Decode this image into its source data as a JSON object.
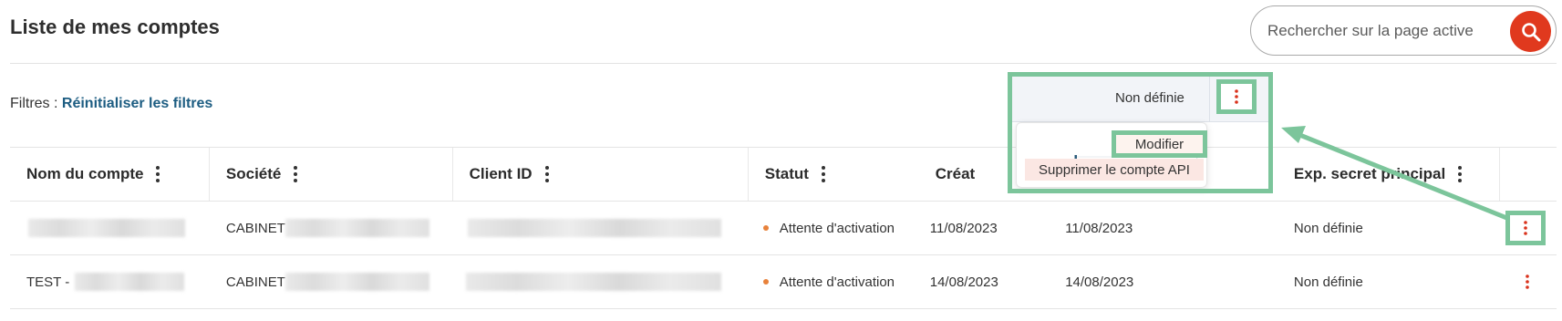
{
  "page": {
    "title": "Liste de mes comptes"
  },
  "search": {
    "placeholder": "Rechercher sur la page active",
    "icon": "search-icon"
  },
  "filters": {
    "label": "Filtres :",
    "reset": "Réinitialiser les filtres"
  },
  "table": {
    "columns": [
      {
        "key": "name",
        "label": "Nom du compte"
      },
      {
        "key": "company",
        "label": "Société"
      },
      {
        "key": "client_id",
        "label": "Client ID"
      },
      {
        "key": "status",
        "label": "Statut"
      },
      {
        "key": "created",
        "label": "Créat"
      },
      {
        "key": "secret",
        "label": "Exp. secret principal"
      }
    ],
    "rows": [
      {
        "name": "",
        "company": "CABINET",
        "status": "Attente d'activation",
        "created": "11/08/2023",
        "col5": "11/08/2023",
        "secret": "Non définie"
      },
      {
        "name": "TEST -",
        "company": "CABINET",
        "status": "Attente d'activation",
        "created": "14/08/2023",
        "col5": "14/08/2023",
        "secret": "Non définie"
      }
    ]
  },
  "popup": {
    "header_value": "Non définie",
    "items": [
      {
        "label": "Modifier"
      },
      {
        "label": "Supprimer le compte API"
      }
    ]
  },
  "colors": {
    "accent": "#e0391e",
    "link": "#1d5d82",
    "highlight": "#7cc59b",
    "status_dot": "#e8823b",
    "kebab_red": "#d9321c"
  }
}
